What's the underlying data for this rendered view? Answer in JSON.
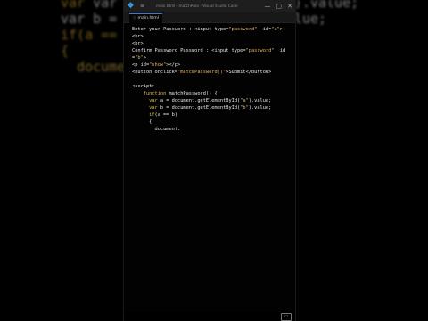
{
  "background_code": {
    "line1": "var a = d",
    "line1_tail": ").value;",
    "line2": "var b = d",
    "line2_tail": ").value;",
    "line3": "if(a == b",
    "line4": "{",
    "line5": "document"
  },
  "window": {
    "title": "main.html - matchPass - Visual Studio Code",
    "menu_glyph": "≡",
    "controls": [
      "—",
      "▢",
      "✕"
    ]
  },
  "tab": {
    "label": "main.html"
  },
  "code_lines": [
    "Enter your Password : <input type=\"password\"  id=\"a\">",
    "<br>",
    "<br>",
    "Confirm Password Password : <input type=\"password\"  id",
    "=\"b\">",
    "<p id=\"show\"></p>",
    "<button onclick=\"matchPassword()\">Submit</button>",
    "",
    "<script>",
    "    function matchPassword() {",
    "      var a = document.getElementById(\"a\").value;",
    "      var b = document.getElementById(\"b\").value;",
    "      if(a == b)",
    "      {",
    "        document."
  ],
  "colors": {
    "background": "#000000",
    "editor": "#020202",
    "accent": "#3a96dd",
    "string": "#e5b567"
  },
  "status": {
    "icon": "layout-icon"
  }
}
